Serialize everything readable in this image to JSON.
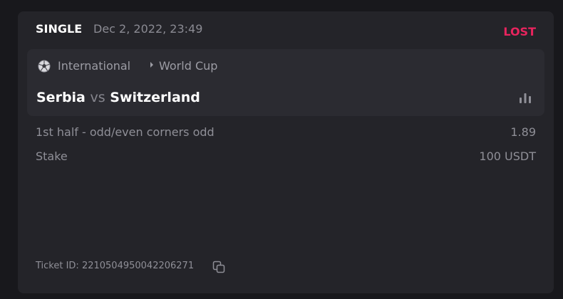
{
  "bet": {
    "type": "SINGLE",
    "date": "Dec 2, 2022, 23:49",
    "status": "LOST",
    "status_color": "#e8245e"
  },
  "event": {
    "sport_icon": "soccer-ball-icon",
    "category": "International",
    "tournament": "World Cup",
    "home": "Serbia",
    "vs": "vs",
    "away": "Switzerland",
    "stats_icon": "bar-chart-icon"
  },
  "selection": {
    "market": "1st half - odd/even corners odd",
    "odds": "1.89"
  },
  "stake": {
    "label": "Stake",
    "value": "100 USDT"
  },
  "ticket": {
    "text": "Ticket ID: 2210504950042206271",
    "copy_icon": "copy-icon"
  }
}
